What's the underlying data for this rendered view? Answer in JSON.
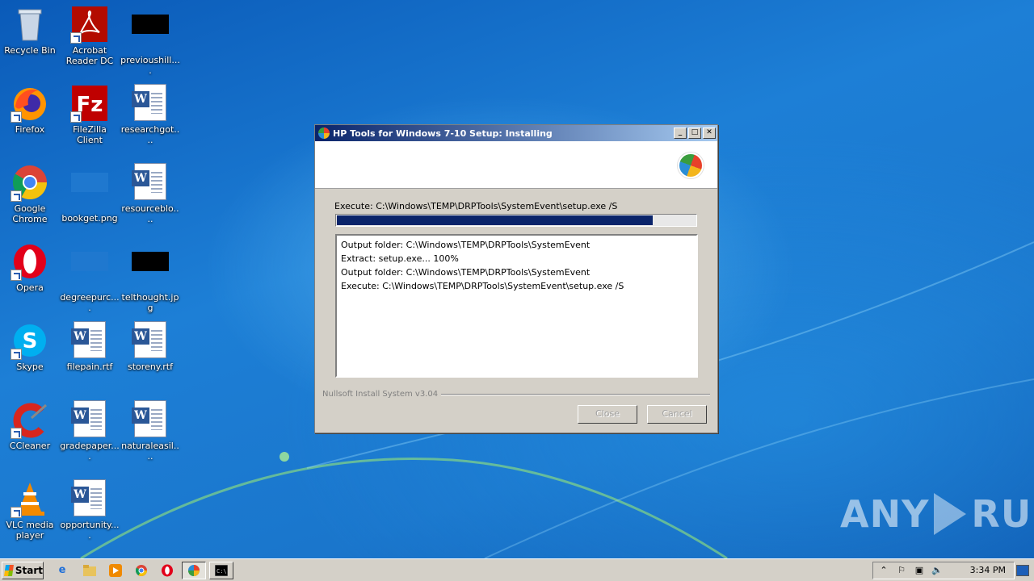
{
  "desktop": {
    "icons": [
      {
        "label": "Recycle Bin",
        "icon": "recycle-bin-icon"
      },
      {
        "label": "Acrobat\nReader DC",
        "icon": "acrobat-icon"
      },
      {
        "label": "previoushill....",
        "icon": "image-file-icon"
      },
      {
        "label": "Firefox",
        "icon": "firefox-icon"
      },
      {
        "label": "FileZilla Client",
        "icon": "filezilla-icon"
      },
      {
        "label": "researchgot....",
        "icon": "word-doc-icon"
      },
      {
        "label": "Google\nChrome",
        "icon": "chrome-icon"
      },
      {
        "label": "bookget.png",
        "icon": "image-file-icon"
      },
      {
        "label": "resourceblo....",
        "icon": "word-doc-icon"
      },
      {
        "label": "Opera",
        "icon": "opera-icon"
      },
      {
        "label": "degreepurc....",
        "icon": "image-file-icon"
      },
      {
        "label": "telthought.jpg",
        "icon": "image-file-icon"
      },
      {
        "label": "Skype",
        "icon": "skype-icon"
      },
      {
        "label": "filepain.rtf",
        "icon": "word-doc-icon"
      },
      {
        "label": "storeny.rtf",
        "icon": "word-doc-icon"
      },
      {
        "label": "CCleaner",
        "icon": "ccleaner-icon"
      },
      {
        "label": "gradepaper....",
        "icon": "word-doc-icon"
      },
      {
        "label": "naturaleasil....",
        "icon": "word-doc-icon"
      },
      {
        "label": "VLC media\nplayer",
        "icon": "vlc-icon"
      },
      {
        "label": "opportunity....",
        "icon": "word-doc-icon"
      }
    ]
  },
  "dialog": {
    "title": "HP Tools for Windows 7-10 Setup: Installing",
    "status": "Execute: C:\\Windows\\TEMP\\DRPTools\\SystemEvent\\setup.exe /S",
    "progress": 0.88,
    "log": [
      "Output folder: C:\\Windows\\TEMP\\DRPTools\\SystemEvent",
      "Extract: setup.exe... 100%",
      "Output folder: C:\\Windows\\TEMP\\DRPTools\\SystemEvent",
      "Execute: C:\\Windows\\TEMP\\DRPTools\\SystemEvent\\setup.exe /S"
    ],
    "branding": "Nullsoft Install System v3.04",
    "close_label": "Close",
    "cancel_label": "Cancel",
    "min_glyph": "_",
    "max_glyph": "□",
    "close_glyph": "✕"
  },
  "taskbar": {
    "start_label": "Start",
    "clock": "3:34 PM"
  },
  "watermark": {
    "left": "ANY",
    "right": "RUN"
  },
  "colors": {
    "titlebar_start": "#0a246a",
    "progress_fill": "#0a246a",
    "desktop_blue": "#1d7fd6"
  }
}
